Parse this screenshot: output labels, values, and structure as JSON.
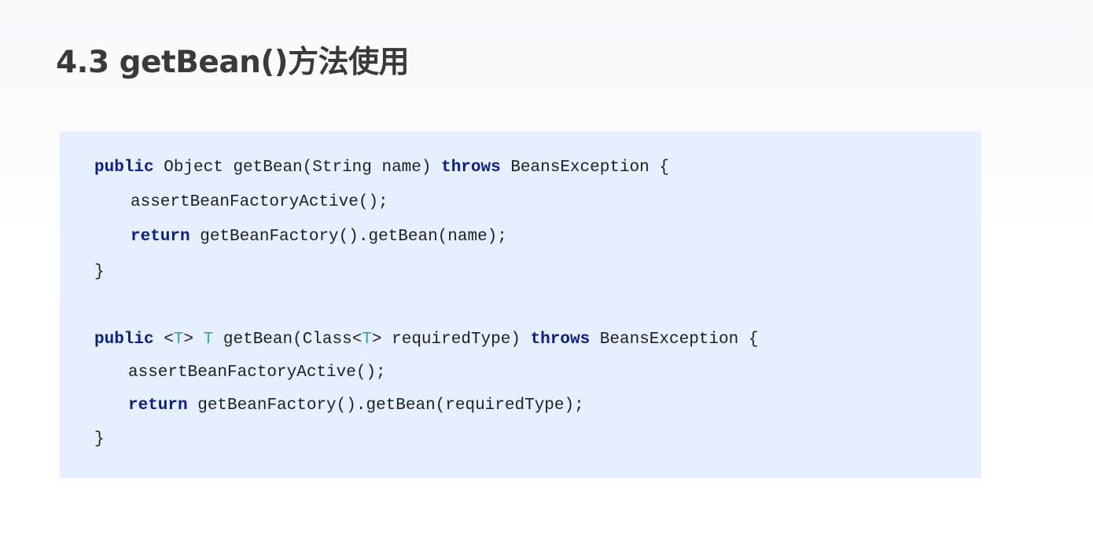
{
  "slide": {
    "title": "4.3 getBean()方法使用"
  },
  "code": {
    "block1": {
      "line1": {
        "kw_public": "public",
        "part_a": " Object getBean(String name) ",
        "kw_throws": "throws",
        "part_b": " BeansException {"
      },
      "line2": {
        "text": "assertBeanFactoryActive();"
      },
      "line3": {
        "kw_return": "return",
        "text": " getBeanFactory().getBean(name);"
      },
      "line4": {
        "text": "}"
      }
    },
    "block2": {
      "line1": {
        "kw_public": "public",
        "part_a": " <",
        "type_t1": "T",
        "part_b": "> ",
        "type_t2": "T",
        "part_c": " getBean(Class<",
        "type_t3": "T",
        "part_d": "> requiredType) ",
        "kw_throws": "throws",
        "part_e": " BeansException {"
      },
      "line2": {
        "text": "assertBeanFactoryActive();"
      },
      "line3": {
        "kw_return": "return",
        "text": " getBeanFactory().getBean(requiredType);"
      },
      "line4": {
        "text": "}"
      }
    }
  }
}
